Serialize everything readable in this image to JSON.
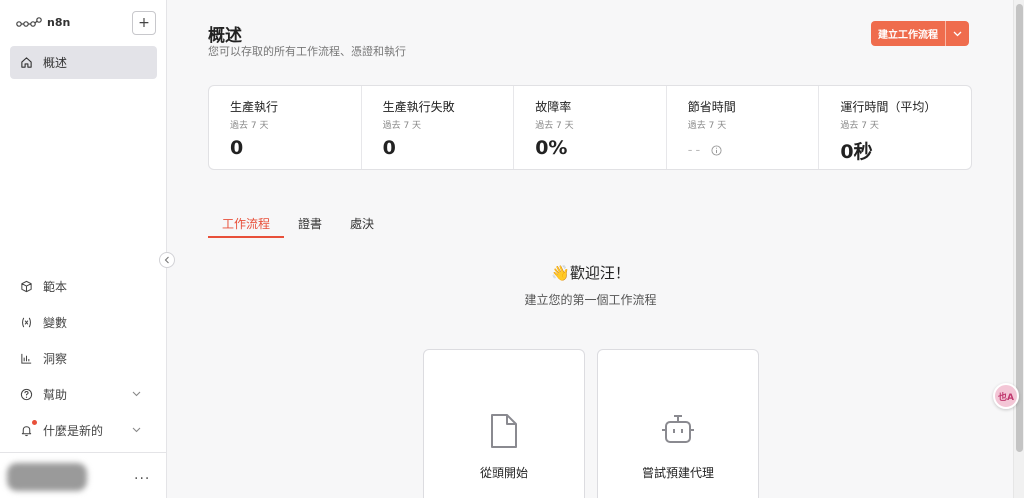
{
  "app": {
    "name": "n8n"
  },
  "sidebar": {
    "active_item": {
      "label": "概述",
      "icon": "home-icon"
    },
    "bottom_items": [
      {
        "label": "範本",
        "icon": "template-icon"
      },
      {
        "label": "變數",
        "icon": "variable-icon"
      },
      {
        "label": "洞察",
        "icon": "insights-icon"
      },
      {
        "label": "幫助",
        "icon": "help-icon"
      },
      {
        "label": "什麼是新的",
        "icon": "bell-icon"
      }
    ],
    "more_label": "...",
    "add_label": "+"
  },
  "header": {
    "title": "概述",
    "subtitle": "您可以存取的所有工作流程、憑證和執行",
    "create_button": "建立工作流程"
  },
  "stats": [
    {
      "label": "生產執行",
      "period": "過去 7 天",
      "value": "0"
    },
    {
      "label": "生產執行失敗",
      "period": "過去 7 天",
      "value": "0"
    },
    {
      "label": "故障率",
      "period": "過去 7 天",
      "value": "0%"
    },
    {
      "label": "節省時間",
      "period": "過去 7 天",
      "value": "--"
    },
    {
      "label": "運行時間（平均）",
      "period": "過去 7 天",
      "value": "0秒"
    }
  ],
  "tabs": [
    {
      "label": "工作流程",
      "active": true
    },
    {
      "label": "證書",
      "active": false
    },
    {
      "label": "處決",
      "active": false
    }
  ],
  "welcome": {
    "title": "👋歡迎汪！",
    "subtitle": "建立您的第一個工作流程"
  },
  "cards": [
    {
      "label": "從頭開始",
      "icon": "file-icon"
    },
    {
      "label": "嘗試預建代理",
      "icon": "robot-icon"
    }
  ],
  "floating_button": {
    "label": "也A"
  },
  "colors": {
    "accent": "#ef6c4d",
    "active_tab": "#e8503a"
  }
}
